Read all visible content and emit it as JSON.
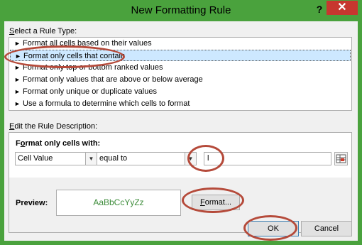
{
  "window": {
    "title": "New Formatting Rule",
    "help_label": "?",
    "close_label": "✕"
  },
  "rule_type": {
    "heading": "Select a Rule Type:",
    "heading_underline": "S",
    "heading_rest": "elect a Rule Type:",
    "items": [
      "Format all cells based on their values",
      "Format only cells that contain",
      "Format only top or bottom ranked values",
      "Format only values that are above or below average",
      "Format only unique or duplicate values",
      "Use a formula to determine which cells to format"
    ],
    "selected_index": 1
  },
  "description": {
    "heading_underline": "E",
    "heading_rest": "dit the Rule Description:",
    "format_only_prefix": "F",
    "format_only_underline": "o",
    "format_only_rest": "rmat only cells with:",
    "condition_type": "Cell Value",
    "operator": "equal to",
    "value": "l",
    "preview_label": "Preview:",
    "preview_text": "AaBbCcYyZz",
    "preview_color": "#3d8c3a",
    "format_button_underline": "F",
    "format_button_rest": "ormat..."
  },
  "buttons": {
    "ok": "OK",
    "cancel": "Cancel"
  },
  "colors": {
    "frame": "#4aa23d",
    "close": "#c7372f",
    "highlight_ring": "#b54a3a",
    "selected_row": "#cde8ff"
  }
}
